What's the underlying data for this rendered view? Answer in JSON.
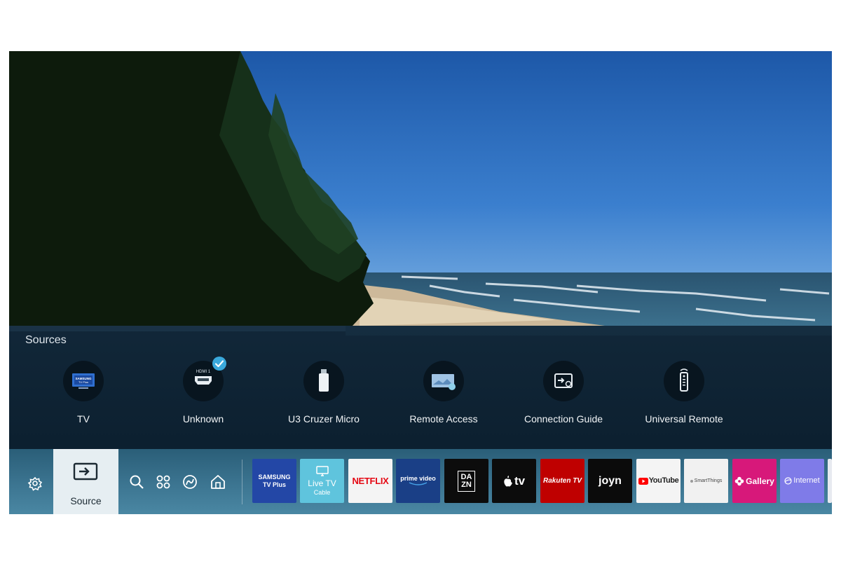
{
  "sources_panel": {
    "title": "Sources",
    "items": [
      {
        "label": "TV",
        "icon": "samsung-tv-plus-icon",
        "badge": "SAMSUNG\nTV Plus"
      },
      {
        "label": "Unknown",
        "icon": "hdmi-icon",
        "badge": "HDMI 1",
        "selected": true
      },
      {
        "label": "U3 Cruzer Micro",
        "icon": "usb-drive-icon"
      },
      {
        "label": "Remote Access",
        "icon": "remote-access-icon"
      },
      {
        "label": "Connection Guide",
        "icon": "connection-guide-icon"
      },
      {
        "label": "Universal Remote",
        "icon": "universal-remote-icon"
      }
    ]
  },
  "bottom_bar": {
    "settings_icon": "gear-icon",
    "source_label": "Source",
    "nav_icons": [
      "search-icon",
      "apps-icon",
      "ambient-icon",
      "home-icon"
    ],
    "apps": [
      {
        "name": "SAMSUNG TV Plus",
        "line1": "SAMSUNG",
        "line2": "TV Plus",
        "bg": "#2347a6",
        "fg": "#ffffff"
      },
      {
        "name": "Live TV",
        "line1": "Live TV",
        "line2": "Cable",
        "bg": "#5fc4dd",
        "fg": "#ffffff"
      },
      {
        "name": "Netflix",
        "line1": "NETFLIX",
        "bg": "#f4f4f4",
        "fg": "#e50914"
      },
      {
        "name": "Prime Video",
        "line1": "prime video",
        "bg": "#1a3f86",
        "fg": "#ffffff"
      },
      {
        "name": "DAZN",
        "line1": "DA",
        "line2": "ZN",
        "bg": "#0c0c0c",
        "fg": "#ffffff"
      },
      {
        "name": "Apple TV",
        "line1": "tv",
        "bg": "#0c0c0c",
        "fg": "#ffffff"
      },
      {
        "name": "Rakuten TV",
        "line1": "Rakuten TV",
        "bg": "#bf0000",
        "fg": "#ffffff"
      },
      {
        "name": "Joyn",
        "line1": "joyn",
        "bg": "#0b0b0b",
        "fg": "#ffffff"
      },
      {
        "name": "YouTube",
        "line1": "YouTube",
        "bg": "#f4f4f4",
        "fg": "#222222"
      },
      {
        "name": "SmartThings",
        "line1": "SmartThings",
        "bg": "#f1f1f1",
        "fg": "#444444"
      },
      {
        "name": "Gallery",
        "line1": "Gallery",
        "bg": "#d7187a",
        "fg": "#ffffff"
      },
      {
        "name": "Internet",
        "line1": "Internet",
        "bg": "#7f7be8",
        "fg": "#ffffff"
      }
    ]
  },
  "colors": {
    "panel": "#12283a",
    "bar": "#3c7591",
    "source_selected": "#e6eef2",
    "check": "#3aa9dc"
  }
}
